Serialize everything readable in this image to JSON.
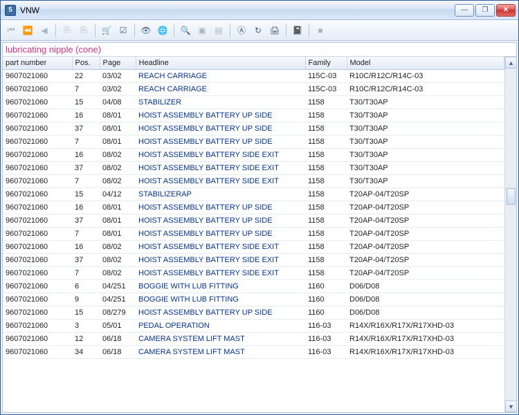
{
  "window": {
    "title": "VNW",
    "icon_glyph": "5"
  },
  "win_controls": {
    "min": "—",
    "max": "❐",
    "close": "✕"
  },
  "toolbar": [
    {
      "name": "nav-first-icon",
      "glyph": "⏮",
      "enabled": false
    },
    {
      "name": "nav-prev-fast-icon",
      "glyph": "⏪",
      "enabled": false
    },
    {
      "name": "nav-prev-icon",
      "glyph": "◀",
      "enabled": false
    },
    {
      "sep": true
    },
    {
      "name": "doc-new-icon",
      "glyph": "⎘",
      "enabled": false
    },
    {
      "name": "doc-copy-icon",
      "glyph": "⎘",
      "enabled": false
    },
    {
      "sep": true
    },
    {
      "name": "cart-icon",
      "glyph": "🛒",
      "enabled": true
    },
    {
      "name": "checklist-icon",
      "glyph": "☑",
      "enabled": true
    },
    {
      "sep": true
    },
    {
      "name": "eye-off-icon",
      "glyph": "👁",
      "enabled": true
    },
    {
      "name": "globe-icon",
      "glyph": "🌐",
      "enabled": true
    },
    {
      "sep": true
    },
    {
      "name": "zoom-icon",
      "glyph": "🔍",
      "enabled": false
    },
    {
      "name": "page-icon",
      "glyph": "▣",
      "enabled": false
    },
    {
      "name": "page-fit-icon",
      "glyph": "▤",
      "enabled": false
    },
    {
      "sep": true
    },
    {
      "name": "anchor-icon",
      "glyph": "Ⓐ",
      "enabled": true
    },
    {
      "name": "refresh-icon",
      "glyph": "↻",
      "enabled": true
    },
    {
      "name": "print-icon",
      "glyph": "🖨",
      "enabled": true
    },
    {
      "sep": true
    },
    {
      "name": "book-icon",
      "glyph": "📓",
      "enabled": false
    },
    {
      "sep": true
    },
    {
      "name": "stop-icon",
      "glyph": "■",
      "enabled": false
    }
  ],
  "caption": "lubricating nipple (cone)",
  "columns": {
    "part": "part number",
    "pos": "Pos.",
    "page": "Page",
    "head": "Headline",
    "fam": "Family",
    "model": "Model"
  },
  "rows": [
    {
      "part": "9607021060",
      "pos": "22",
      "page": "03/02",
      "head": "REACH CARRIAGE",
      "fam": "115C-03",
      "model": "R10C/R12C/R14C-03"
    },
    {
      "part": "9607021060",
      "pos": "7",
      "page": "03/02",
      "head": "REACH CARRIAGE",
      "fam": "115C-03",
      "model": "R10C/R12C/R14C-03"
    },
    {
      "part": "9607021060",
      "pos": "15",
      "page": "04/08",
      "head": "STABILIZER",
      "fam": "1158",
      "model": "T30/T30AP"
    },
    {
      "part": "9607021060",
      "pos": "16",
      "page": "08/01",
      "head": "HOIST ASSEMBLY BATTERY UP SIDE",
      "fam": "1158",
      "model": "T30/T30AP"
    },
    {
      "part": "9607021060",
      "pos": "37",
      "page": "08/01",
      "head": "HOIST ASSEMBLY BATTERY UP SIDE",
      "fam": "1158",
      "model": "T30/T30AP"
    },
    {
      "part": "9607021060",
      "pos": "7",
      "page": "08/01",
      "head": "HOIST ASSEMBLY BATTERY UP SIDE",
      "fam": "1158",
      "model": "T30/T30AP"
    },
    {
      "part": "9607021060",
      "pos": "16",
      "page": "08/02",
      "head": "HOIST ASSEMBLY BATTERY SIDE EXIT",
      "fam": "1158",
      "model": "T30/T30AP"
    },
    {
      "part": "9607021060",
      "pos": "37",
      "page": "08/02",
      "head": "HOIST ASSEMBLY BATTERY SIDE EXIT",
      "fam": "1158",
      "model": "T30/T30AP"
    },
    {
      "part": "9607021060",
      "pos": "7",
      "page": "08/02",
      "head": "HOIST ASSEMBLY BATTERY SIDE EXIT",
      "fam": "1158",
      "model": "T30/T30AP"
    },
    {
      "part": "9607021060",
      "pos": "15",
      "page": "04/12",
      "head": "STABILIZERAP",
      "fam": "1158",
      "model": "T20AP-04/T20SP"
    },
    {
      "part": "9607021060",
      "pos": "16",
      "page": "08/01",
      "head": "HOIST ASSEMBLY BATTERY UP SIDE",
      "fam": "1158",
      "model": "T20AP-04/T20SP"
    },
    {
      "part": "9607021060",
      "pos": "37",
      "page": "08/01",
      "head": "HOIST ASSEMBLY BATTERY UP SIDE",
      "fam": "1158",
      "model": "T20AP-04/T20SP"
    },
    {
      "part": "9607021060",
      "pos": "7",
      "page": "08/01",
      "head": "HOIST ASSEMBLY BATTERY UP SIDE",
      "fam": "1158",
      "model": "T20AP-04/T20SP"
    },
    {
      "part": "9607021060",
      "pos": "16",
      "page": "08/02",
      "head": "HOIST ASSEMBLY BATTERY SIDE EXIT",
      "fam": "1158",
      "model": "T20AP-04/T20SP"
    },
    {
      "part": "9607021060",
      "pos": "37",
      "page": "08/02",
      "head": "HOIST ASSEMBLY BATTERY SIDE EXIT",
      "fam": "1158",
      "model": "T20AP-04/T20SP"
    },
    {
      "part": "9607021060",
      "pos": "7",
      "page": "08/02",
      "head": "HOIST ASSEMBLY BATTERY SIDE EXIT",
      "fam": "1158",
      "model": "T20AP-04/T20SP"
    },
    {
      "part": "9607021060",
      "pos": "6",
      "page": "04/251",
      "head": "BOGGIE WITH LUB FITTING",
      "fam": "1160",
      "model": "D06/D08"
    },
    {
      "part": "9607021060",
      "pos": "9",
      "page": "04/251",
      "head": "BOGGIE WITH LUB FITTING",
      "fam": "1160",
      "model": "D06/D08"
    },
    {
      "part": "9607021060",
      "pos": "15",
      "page": "08/279",
      "head": "HOIST ASSEMBLY BATTERY UP SIDE",
      "fam": "1160",
      "model": "D06/D08"
    },
    {
      "part": "9607021060",
      "pos": "3",
      "page": "05/01",
      "head": "PEDAL OPERATION",
      "fam": "116-03",
      "model": "R14X/R16X/R17X/R17XHD-03"
    },
    {
      "part": "9607021060",
      "pos": "12",
      "page": "06/18",
      "head": "CAMERA SYSTEM LIFT MAST",
      "fam": "116-03",
      "model": "R14X/R16X/R17X/R17XHD-03"
    },
    {
      "part": "9607021060",
      "pos": "34",
      "page": "06/18",
      "head": "CAMERA SYSTEM LIFT MAST",
      "fam": "116-03",
      "model": "R14X/R16X/R17X/R17XHD-03"
    }
  ]
}
